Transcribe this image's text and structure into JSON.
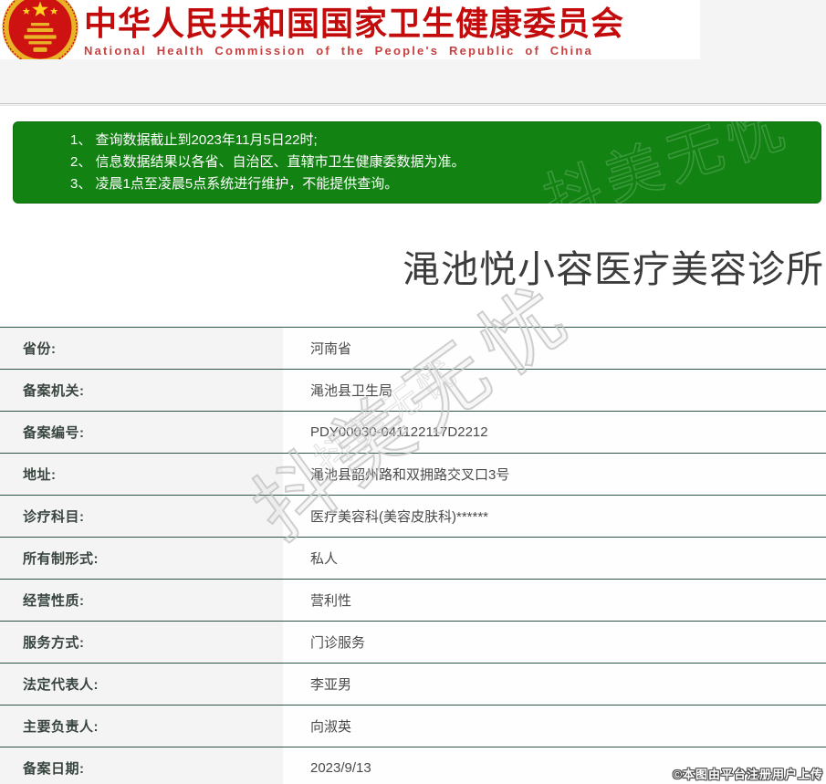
{
  "colors": {
    "header_red": "#c40b0b",
    "notice_green": "#128212",
    "table_divider": "#2e544c"
  },
  "header": {
    "emblem_icon": "china-national-emblem",
    "title_cn": "中华人民共和国国家卫生健康委员会",
    "title_en": "National Health Commission of the People's Republic of China"
  },
  "notice": {
    "items": [
      "1、 查询数据截止到2023年11月5日22时;",
      "2、 信息数据结果以各省、自治区、直辖市卫生健康委数据为准。",
      "3、 凌晨1点至凌晨5点系统进行维护，不能提供查询。"
    ]
  },
  "facility": {
    "name": "渑池悦小容医疗美容诊所"
  },
  "info_table": {
    "rows": [
      {
        "label": "省份:",
        "value": "河南省"
      },
      {
        "label": "备案机关:",
        "value": "渑池县卫生局"
      },
      {
        "label": "备案编号:",
        "value": "PDY00030-041122117D2212"
      },
      {
        "label": "地址:",
        "value": "渑池县韶州路和双拥路交叉口3号"
      },
      {
        "label": "诊疗科目:",
        "value": "医疗美容科(美容皮肤科)******"
      },
      {
        "label": "所有制形式:",
        "value": "私人"
      },
      {
        "label": "经营性质:",
        "value": "营利性"
      },
      {
        "label": "服务方式:",
        "value": "门诊服务"
      },
      {
        "label": "法定代表人:",
        "value": "李亚男"
      },
      {
        "label": "主要负责人:",
        "value": "向淑英"
      },
      {
        "label": "备案日期:",
        "value": "2023/9/13"
      }
    ]
  },
  "watermarks": {
    "diagonal_text": "抖美无忧",
    "copyright_text": "©本图由平台注册用户上传"
  }
}
